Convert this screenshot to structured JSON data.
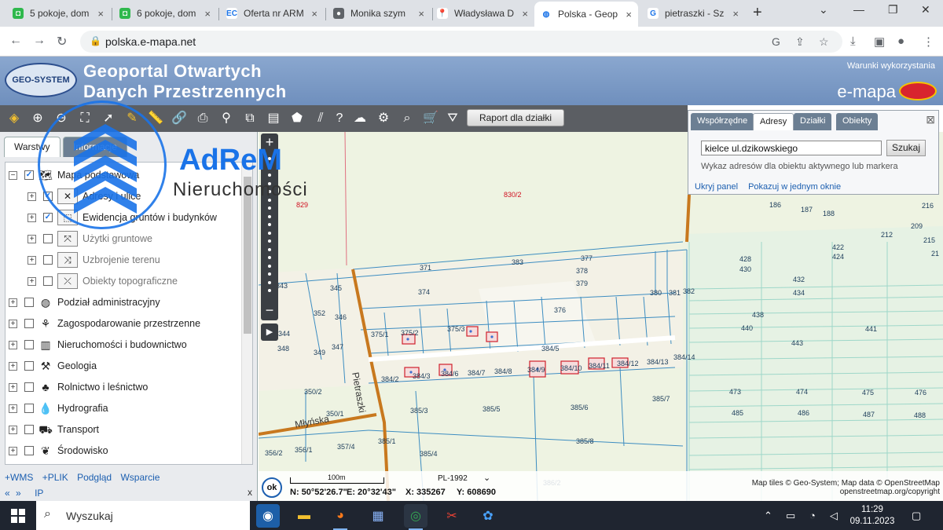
{
  "browser": {
    "tabs": [
      {
        "title": "5 pokoje, dom",
        "fav_color": "#2fb84d",
        "fav_char": "◘"
      },
      {
        "title": "6 pokoje, dom",
        "fav_color": "#2fb84d",
        "fav_char": "◘"
      },
      {
        "title": "Oferta nr ARM",
        "fav_color": "#ffffff",
        "fav_char": "EC"
      },
      {
        "title": "Monika szym",
        "fav_color": "#5f6368",
        "fav_char": "●"
      },
      {
        "title": "Władysława D",
        "fav_color": "#ffffff",
        "fav_char": "📍"
      },
      {
        "title": "Polska - Geop",
        "fav_color": "#ffffff",
        "fav_char": "◍"
      },
      {
        "title": "pietraszki - Sz",
        "fav_color": "#ffffff",
        "fav_char": "G"
      }
    ],
    "active_tab_index": 5,
    "url": "polska.e-mapa.net",
    "new_tab_label": "+"
  },
  "header": {
    "logo_text": "GEO-SYSTEM",
    "title_line1": "Geoportal Otwartych",
    "title_line2": "Danych Przestrzennych",
    "terms_link": "Warunki wykorzystania",
    "brand": "e-mapa"
  },
  "toolbar": {
    "report_button": "Raport dla działki"
  },
  "left_panel": {
    "tabs": [
      "Warstwy",
      "Informacje"
    ],
    "layers": [
      {
        "label": "Mapa podstawowa",
        "checked": true,
        "level": 0,
        "icon": "map-layer-icon"
      },
      {
        "label": "Adresy i ulice",
        "checked": true,
        "level": 1,
        "icon": "address-layer-icon"
      },
      {
        "label": "Ewidencja gruntów i budynków",
        "checked": true,
        "level": 1,
        "icon": "cadastre-layer-icon"
      },
      {
        "label": "Użytki gruntowe",
        "checked": false,
        "level": 1,
        "icon": "land-use-layer-icon"
      },
      {
        "label": "Uzbrojenie terenu",
        "checked": false,
        "level": 1,
        "icon": "utilities-layer-icon"
      },
      {
        "label": "Obiekty topograficzne",
        "checked": false,
        "level": 1,
        "icon": "topo-layer-icon"
      },
      {
        "label": "Podział administracyjny",
        "checked": false,
        "level": 0,
        "icon": "admin-division-icon"
      },
      {
        "label": "Zagospodarowanie przestrzenne",
        "checked": false,
        "level": 0,
        "icon": "spatial-planning-icon"
      },
      {
        "label": "Nieruchomości i budownictwo",
        "checked": false,
        "level": 0,
        "icon": "real-estate-icon"
      },
      {
        "label": "Geologia",
        "checked": false,
        "level": 0,
        "icon": "geology-icon"
      },
      {
        "label": "Rolnictwo i leśnictwo",
        "checked": false,
        "level": 0,
        "icon": "agriculture-icon"
      },
      {
        "label": "Hydrografia",
        "checked": false,
        "level": 0,
        "icon": "hydrography-icon"
      },
      {
        "label": "Transport",
        "checked": false,
        "level": 0,
        "icon": "transport-icon"
      },
      {
        "label": "Środowisko",
        "checked": false,
        "level": 0,
        "icon": "environment-icon"
      }
    ],
    "links": [
      "+WMS",
      "+PLIK",
      "Podgląd",
      "Wsparcie"
    ],
    "links2": [
      "«",
      "»",
      "IP"
    ],
    "close": "x"
  },
  "search_panel": {
    "tabs": [
      "Współrzędne",
      "Adresy",
      "Działki",
      "Obiekty"
    ],
    "active_tab": 1,
    "query": "kielce ul.dzikowskiego",
    "search_button": "Szukaj",
    "hint": "Wykaz adresów dla obiektu aktywnego lub markera",
    "links": [
      "Ukryj panel",
      "Pokazuj w jednym oknie"
    ]
  },
  "map": {
    "parcels": [
      "829",
      "830/2",
      "371",
      "383",
      "377",
      "378",
      "379",
      "343",
      "345",
      "374",
      "376",
      "380",
      "381",
      "382",
      "352",
      "346",
      "375/1",
      "375/2",
      "375/3",
      "344",
      "348",
      "349",
      "347",
      "384/5",
      "384/14",
      "384/2",
      "384/3",
      "384/6",
      "384/7",
      "384/8",
      "384/9",
      "384/10",
      "384/11",
      "384/12",
      "384/13",
      "350/2",
      "385/3",
      "385/5",
      "385/6",
      "385/7",
      "350/1",
      "385/1",
      "357/4",
      "385/4",
      "356/2",
      "356/1",
      "385/8",
      "386/2",
      "441",
      "440",
      "438",
      "443",
      "473",
      "474",
      "475",
      "476",
      "485",
      "486",
      "487",
      "488",
      "428",
      "430",
      "432",
      "434",
      "422",
      "424",
      "186",
      "187",
      "188",
      "209",
      "216",
      "212",
      "215",
      "21"
    ],
    "red_parcels": [
      "829",
      "830/2"
    ],
    "streets": [
      "Pietraszki",
      "Młyńska"
    ],
    "status": {
      "ok": "ok",
      "scale": "100m",
      "crs": "PL-1992",
      "lat": "N: 50°52'26.7\"",
      "lon": "E: 20°32'43\"",
      "x": "X: 335267",
      "y": "Y: 608690"
    },
    "attribution_line1": "Map tiles © Geo-System; Map data © OpenStreetMap",
    "attribution_line2": "openstreetmap.org/copyright"
  },
  "watermark": {
    "name": "AdReM",
    "subtitle": "Nieruchomości"
  },
  "taskbar": {
    "search_placeholder": "Wyszukaj",
    "time": "11:29",
    "date": "09.11.2023"
  }
}
